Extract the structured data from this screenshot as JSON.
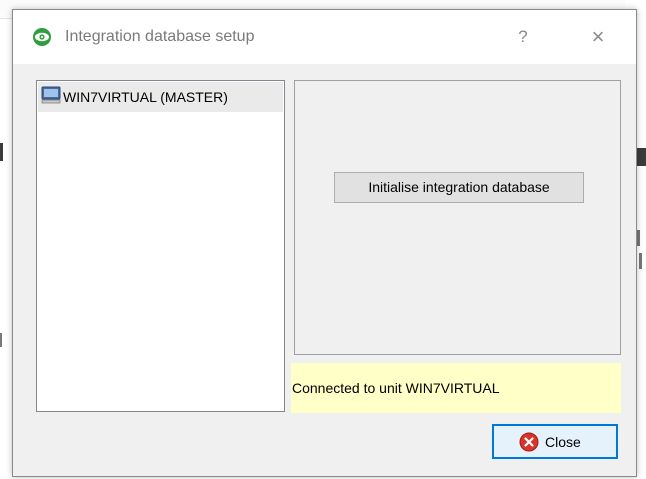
{
  "dialog": {
    "title": "Integration database setup",
    "help_label": "?",
    "close_glyph": "×",
    "app_icon": "eye-icon",
    "accent_color": "#0078d7"
  },
  "unit_list": {
    "items": [
      {
        "label": "WIN7VIRTUAL (MASTER)",
        "icon": "computer-icon",
        "selected": true
      }
    ]
  },
  "actions": {
    "initialise_label": "Initialise integration database"
  },
  "status": {
    "text": "Connected to unit WIN7VIRTUAL",
    "background": "#ffffc8"
  },
  "footer": {
    "close_label": "Close",
    "close_icon": "close-circle-icon"
  }
}
